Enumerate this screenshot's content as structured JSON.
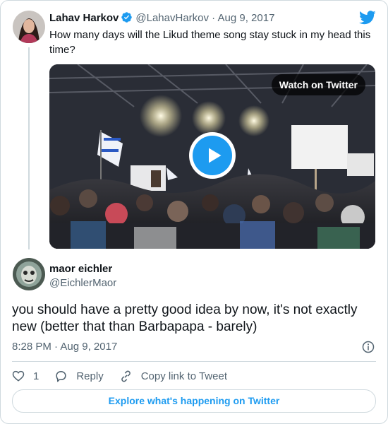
{
  "parent_tweet": {
    "author_name": "Lahav Harkov",
    "handle": "@LahavHarkov",
    "separator": "·",
    "date": "Aug 9, 2017",
    "text": "How many days will the Likud theme song stay stuck in my head this time?",
    "media": {
      "watch_label": "Watch on Twitter"
    }
  },
  "reply_tweet": {
    "author_name": "maor eichler",
    "handle": "@EichlerMaor",
    "text": "you should have a pretty good idea by now, it's not exactly new (better that than Barbapapa - barely)",
    "time": "8:28 PM",
    "separator": "·",
    "date": "Aug 9, 2017"
  },
  "actions": {
    "like_count": "1",
    "reply_label": "Reply",
    "copy_link_label": "Copy link to Tweet"
  },
  "explore_label": "Explore what's happening on Twitter",
  "icons": {
    "brand": "twitter-bird-icon",
    "verified": "verified-badge-icon",
    "play": "play-icon",
    "info": "info-icon",
    "like": "heart-icon",
    "reply": "reply-bubble-icon",
    "link": "link-icon"
  },
  "colors": {
    "accent": "#1d9bf0",
    "text": "#0f1419",
    "muted": "#536471",
    "border": "#cfd9de"
  }
}
